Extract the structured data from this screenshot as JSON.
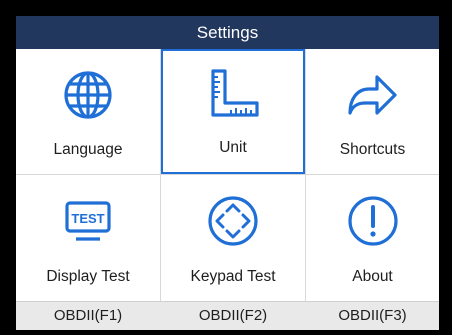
{
  "header": {
    "title": "Settings"
  },
  "menu": [
    {
      "label": "Language",
      "icon": "globe-icon",
      "selected": false
    },
    {
      "label": "Unit",
      "icon": "ruler-icon",
      "selected": true
    },
    {
      "label": "Shortcuts",
      "icon": "arrow-right-icon",
      "selected": false
    },
    {
      "label": "Display Test",
      "icon": "monitor-test-icon",
      "selected": false
    },
    {
      "label": "Keypad Test",
      "icon": "dpad-icon",
      "selected": false
    },
    {
      "label": "About",
      "icon": "exclamation-icon",
      "selected": false
    }
  ],
  "function_keys": [
    {
      "label": "OBDII(F1)"
    },
    {
      "label": "OBDII(F2)"
    },
    {
      "label": "OBDII(F3)"
    }
  ],
  "colors": {
    "title_bar": "#22375d",
    "icon_blue": "#1f6fd6",
    "selection_border": "#1f6fd6",
    "function_bar": "#e9e9e9"
  }
}
